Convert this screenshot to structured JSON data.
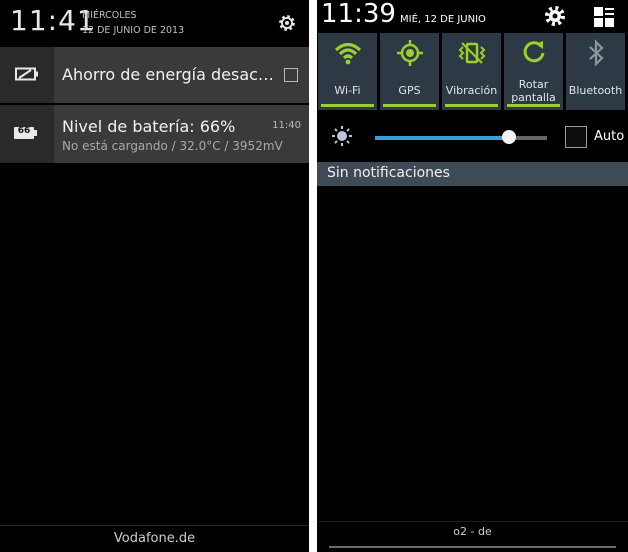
{
  "left": {
    "time": "11:41",
    "day": "MIÉRCOLES",
    "date": "12 DE JUNIO DE 2013",
    "notifications": [
      {
        "title": "Ahorro de energía desac…",
        "subtitle": "",
        "time": "",
        "icon": "battery-saver-icon"
      },
      {
        "title": "Nivel de batería: 66%",
        "subtitle": "No está cargando / 32.0°C / 3952mV",
        "time": "11:40",
        "icon": "battery-level-icon",
        "badge": "66"
      }
    ],
    "carrier": "Vodafone.de"
  },
  "right": {
    "time": "11:39",
    "date": "MIÉ, 12 DE JUNIO",
    "quick_settings": [
      {
        "label": "Wi-Fi",
        "icon": "wifi-icon",
        "active": true
      },
      {
        "label": "GPS",
        "icon": "gps-icon",
        "active": true
      },
      {
        "label": "Vibración",
        "icon": "vibration-icon",
        "active": true
      },
      {
        "label": "Rotar pantalla",
        "label_line1": "Rotar",
        "label_line2": "pantalla",
        "icon": "rotate-icon",
        "active": true
      },
      {
        "label": "Bluetooth",
        "icon": "bluetooth-icon",
        "active": false
      }
    ],
    "brightness": {
      "level": 0.78,
      "auto_label": "Auto",
      "auto_checked": false
    },
    "no_notifications": "Sin notificaciones",
    "carrier": "o2 - de"
  },
  "colors": {
    "accent_green": "#9bd02c",
    "slider_blue": "#39a0de",
    "tile_bg": "#2d3a45"
  }
}
